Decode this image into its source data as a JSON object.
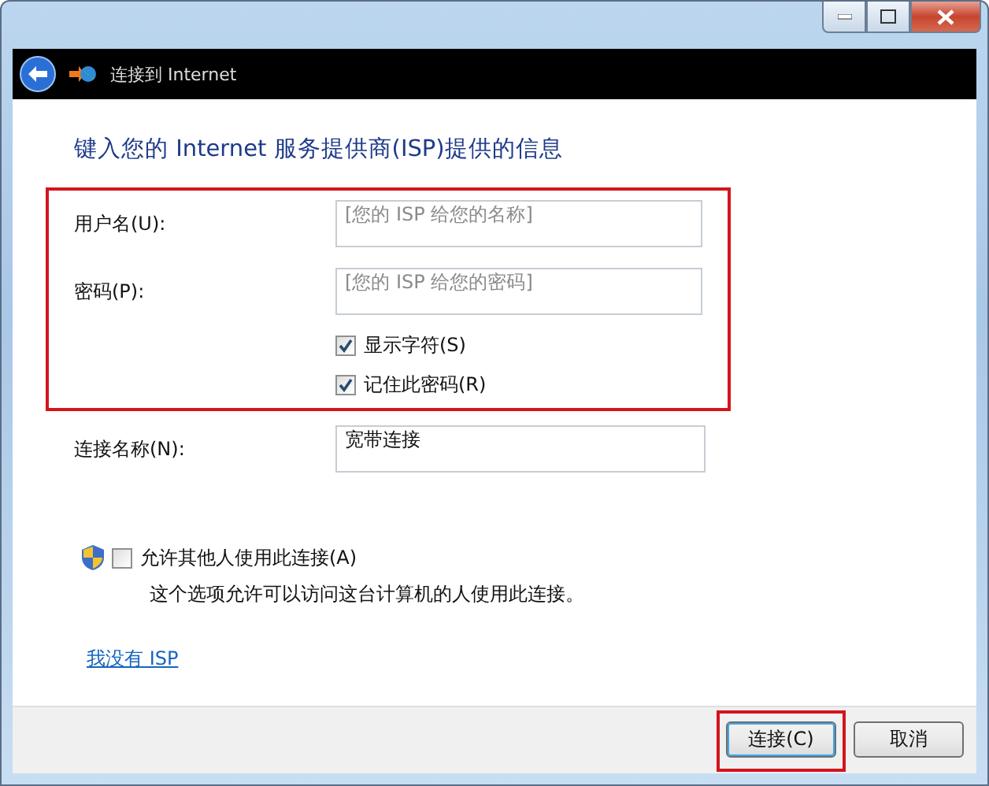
{
  "nav": {
    "title": "连接到 Internet"
  },
  "heading": "键入您的 Internet 服务提供商(ISP)提供的信息",
  "credentials": {
    "highlighted": true,
    "fields": [
      {
        "label": "用户名(U):",
        "placeholder": "[您的 ISP 给您的名称]"
      },
      {
        "label": "密码(P):",
        "placeholder": "[您的 ISP 给您的密码]"
      }
    ],
    "options": [
      {
        "label": "显示字符(S)",
        "checked": true
      },
      {
        "label": "记住此密码(R)",
        "checked": true
      }
    ]
  },
  "connection_name": {
    "label": "连接名称(N):",
    "value": "宽带连接"
  },
  "allow_others": {
    "label": "允许其他人使用此连接(A)",
    "checked": false,
    "description": "这个选项允许可以访问这台计算机的人使用此连接。"
  },
  "link": "我没有 ISP",
  "buttons": [
    {
      "label": "连接(C)",
      "highlighted": true
    },
    {
      "label": "取消",
      "highlighted": false
    }
  ]
}
